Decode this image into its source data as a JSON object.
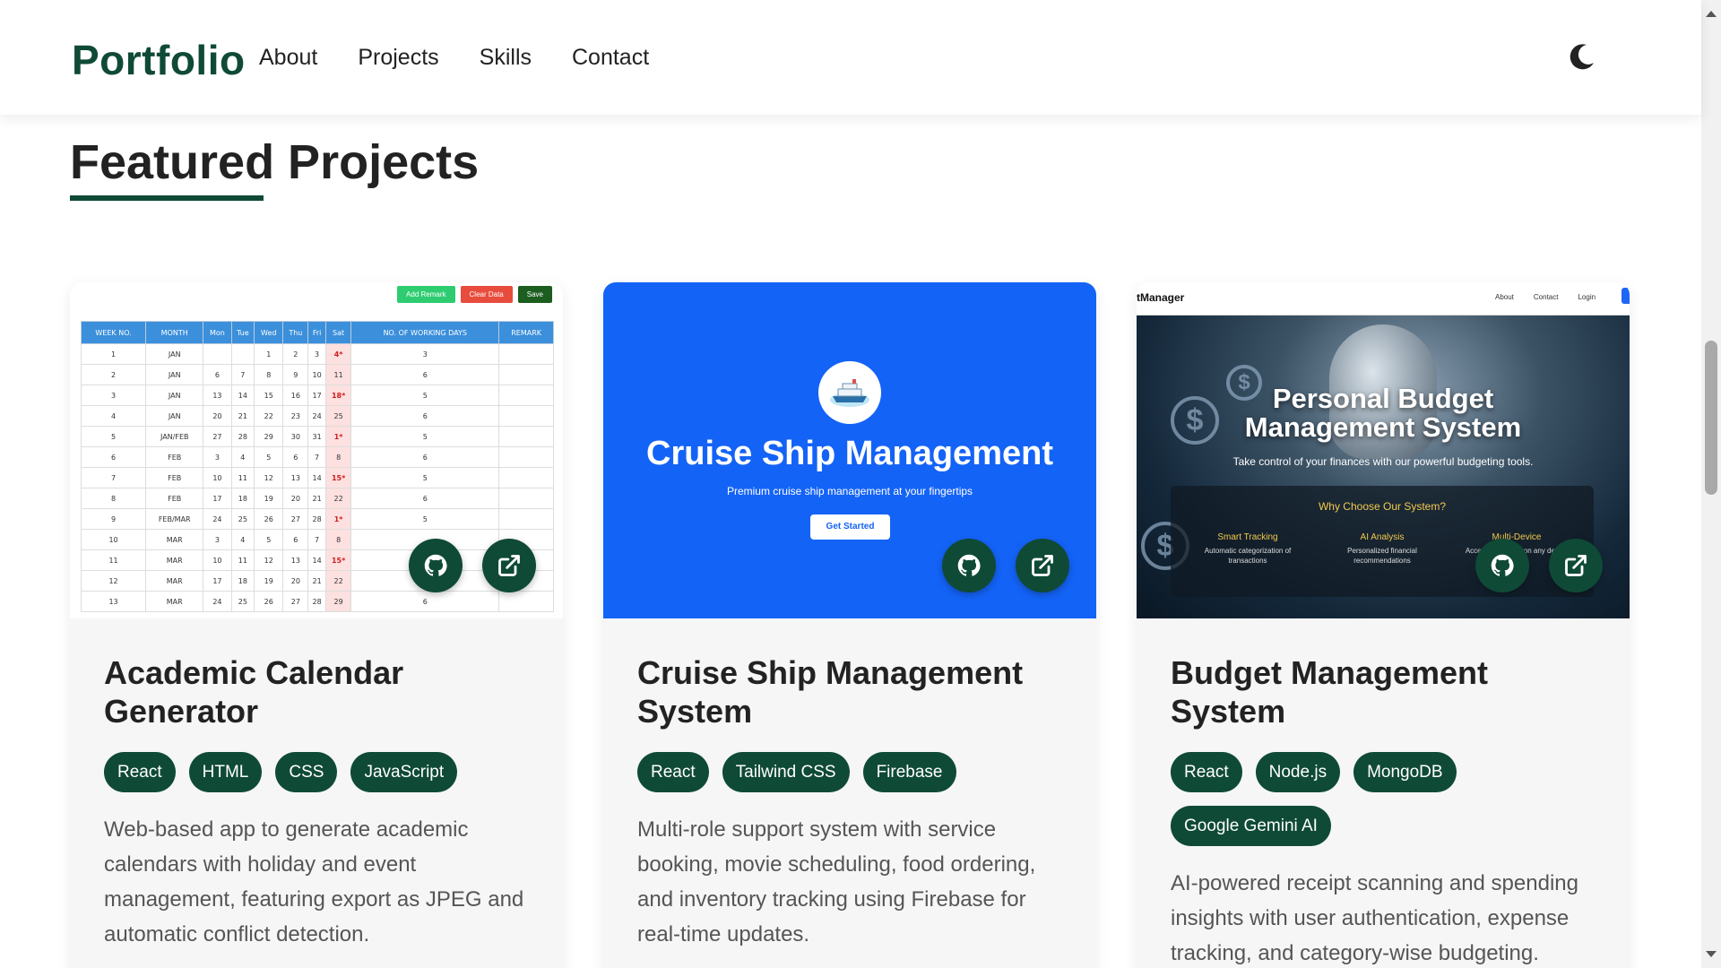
{
  "nav": {
    "brand": "Portfolio",
    "links": [
      "About",
      "Projects",
      "Skills",
      "Contact"
    ],
    "theme_icon": "moon-icon"
  },
  "section": {
    "title": "Featured Projects",
    "accent_color": "#0f4a36"
  },
  "projects": [
    {
      "title": "Academic Calendar Generator",
      "tags": [
        "React",
        "HTML",
        "CSS",
        "JavaScript"
      ],
      "description": "Web-based app to generate academic calendars with holiday and event management, featuring export as JPEG and automatic conflict detection.",
      "preview": {
        "buttons": [
          "Add Remark",
          "Clear Data",
          "Save"
        ],
        "headers": [
          "WEEK NO.",
          "MONTH",
          "Mon",
          "Tue",
          "Wed",
          "Thu",
          "Fri",
          "Sat",
          "NO. OF WORKING DAYS",
          "REMARK"
        ],
        "rows": [
          [
            "1",
            "JAN",
            "",
            "",
            "1",
            "2",
            "3",
            "4*",
            "3",
            ""
          ],
          [
            "2",
            "JAN",
            "6",
            "7",
            "8",
            "9",
            "10",
            "11",
            "6",
            ""
          ],
          [
            "3",
            "JAN",
            "13",
            "14",
            "15",
            "16",
            "17",
            "18*",
            "5",
            ""
          ],
          [
            "4",
            "JAN",
            "20",
            "21",
            "22",
            "23",
            "24",
            "25",
            "6",
            ""
          ],
          [
            "5",
            "JAN/FEB",
            "27",
            "28",
            "29",
            "30",
            "31",
            "1*",
            "5",
            ""
          ],
          [
            "6",
            "FEB",
            "3",
            "4",
            "5",
            "6",
            "7",
            "8",
            "6",
            ""
          ],
          [
            "7",
            "FEB",
            "10",
            "11",
            "12",
            "13",
            "14",
            "15*",
            "5",
            ""
          ],
          [
            "8",
            "FEB",
            "17",
            "18",
            "19",
            "20",
            "21",
            "22",
            "6",
            ""
          ],
          [
            "9",
            "FEB/MAR",
            "24",
            "25",
            "26",
            "27",
            "28",
            "1*",
            "5",
            ""
          ],
          [
            "10",
            "MAR",
            "3",
            "4",
            "5",
            "6",
            "7",
            "8",
            "",
            ""
          ],
          [
            "11",
            "MAR",
            "10",
            "11",
            "12",
            "13",
            "14",
            "15*",
            "",
            ""
          ],
          [
            "12",
            "MAR",
            "17",
            "18",
            "19",
            "20",
            "21",
            "22",
            "",
            ""
          ],
          [
            "13",
            "MAR",
            "24",
            "25",
            "26",
            "27",
            "28",
            "29",
            "6",
            ""
          ]
        ]
      }
    },
    {
      "title": "Cruise Ship Management System",
      "tags": [
        "React",
        "Tailwind CSS",
        "Firebase"
      ],
      "description": "Multi-role support system with service booking, movie scheduling, food ordering, and inventory tracking using Firebase for real-time updates.",
      "preview": {
        "title": "Cruise Ship Management",
        "subtitle": "Premium cruise ship management at your fingertips",
        "cta": "Get Started"
      }
    },
    {
      "title": "Budget Management System",
      "tags": [
        "React",
        "Node.js",
        "MongoDB",
        "Google Gemini AI"
      ],
      "description": "AI-powered receipt scanning and spending insights with user authentication, expense tracking, and category-wise budgeting.",
      "preview": {
        "logo": "tManager",
        "links": [
          "About",
          "Contact",
          "Login"
        ],
        "title_line1": "Personal Budget",
        "title_line2": "Management System",
        "subtitle": "Take control of your finances with our powerful budgeting tools.",
        "box_title": "Why Choose Our System?",
        "features": [
          {
            "name": "Smart Tracking",
            "desc": "Automatic categorization of transactions"
          },
          {
            "name": "AI Analysis",
            "desc": "Personalized financial recommendations"
          },
          {
            "name": "Multi-Device",
            "desc": "Access anywhere on any device"
          }
        ]
      }
    }
  ]
}
